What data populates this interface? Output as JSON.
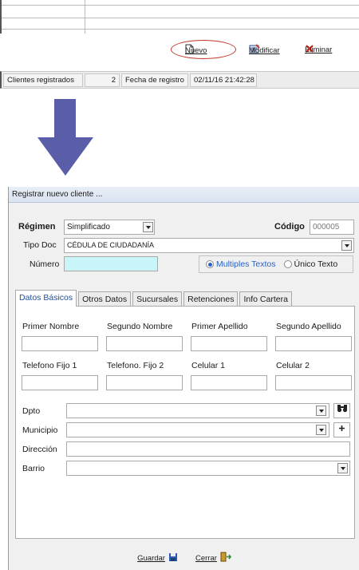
{
  "toolbar": {
    "nuevo_label": "Nuevo",
    "modificar_label": "Modificar",
    "eliminar_label": "Eliminar"
  },
  "statusbar": {
    "clientes_label": "Clientes registrados",
    "clientes_count": "2",
    "fecha_label": "Fecha de registro",
    "fecha_value": "02/11/16 21:42:28"
  },
  "dialog": {
    "title": "Registrar nuevo cliente ...",
    "regimen_label": "Régimen",
    "regimen_value": "Simplificado",
    "codigo_label": "Código",
    "codigo_value": "000005",
    "tipodoc_label": "Tipo Doc",
    "tipodoc_value": "CÉDULA DE CIUDADANÍA",
    "numero_label": "Número",
    "numero_value": "",
    "radio_multiples": "Multiples Textos",
    "radio_unico": "Único Texto",
    "tabs": [
      {
        "label": "Datos Básicos"
      },
      {
        "label": "Otros Datos"
      },
      {
        "label": "Sucursales"
      },
      {
        "label": "Retenciones"
      },
      {
        "label": "Info Cartera"
      }
    ],
    "fields": {
      "primer_nombre": "Primer Nombre",
      "segundo_nombre": "Segundo Nombre",
      "primer_apellido": "Primer Apellido",
      "segundo_apellido": "Segundo Apellido",
      "telefono_fijo1": "Telefono Fijo 1",
      "telefono_fijo2": "Telefono. Fijo 2",
      "celular1": "Celular 1",
      "celular2": "Celular 2",
      "dpto": "Dpto",
      "municipio": "Municipio",
      "direccion": "Dirección",
      "barrio": "Barrio"
    },
    "guardar_label": "Guardar",
    "cerrar_label": "Cerrar"
  },
  "colors": {
    "arrow": "#5a5ea9",
    "numero_fill": "#c9f4f8",
    "nuevo_highlight": "#c0392b",
    "eliminar_x": "#d9261c"
  },
  "icons": [
    "new-document-icon",
    "edit-form-icon",
    "delete-x-icon",
    "binoculars-icon",
    "plus-icon",
    "save-disk-icon",
    "exit-door-icon"
  ]
}
